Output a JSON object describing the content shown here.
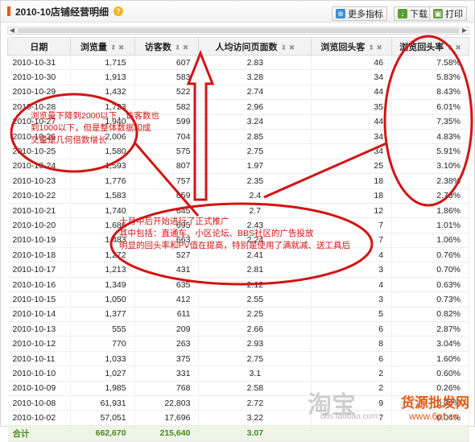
{
  "header": {
    "title": "2010-10店铺经营明细",
    "more_metrics_label": "更多指标",
    "download_label": "下载",
    "print_label": "打印"
  },
  "table": {
    "columns": [
      "日期",
      "浏览量",
      "访客数",
      "人均访问页面数",
      "浏览回头客",
      "浏览回头率"
    ],
    "rows": [
      [
        "2010-10-31",
        "1,715",
        "607",
        "2.83",
        "46",
        "7.58%"
      ],
      [
        "2010-10-30",
        "1,913",
        "583",
        "3.28",
        "34",
        "5.83%"
      ],
      [
        "2010-10-29",
        "1,432",
        "522",
        "2.74",
        "44",
        "8.43%"
      ],
      [
        "2010-10-28",
        "1,723",
        "582",
        "2.96",
        "35",
        "6.01%"
      ],
      [
        "2010-10-27",
        "1,940",
        "599",
        "3.24",
        "44",
        "7.35%"
      ],
      [
        "2010-10-26",
        "2,006",
        "704",
        "2.85",
        "34",
        "4.83%"
      ],
      [
        "2010-10-25",
        "1,580",
        "575",
        "2.75",
        "34",
        "5.91%"
      ],
      [
        "2010-10-24",
        "1,593",
        "807",
        "1.97",
        "25",
        "3.10%"
      ],
      [
        "2010-10-23",
        "1,776",
        "757",
        "2.35",
        "18",
        "2.38%"
      ],
      [
        "2010-10-22",
        "1,583",
        "659",
        "2.4",
        "18",
        "2.73%"
      ],
      [
        "2010-10-21",
        "1,740",
        "645",
        "2.7",
        "12",
        "1.86%"
      ],
      [
        "2010-10-20",
        "1,686",
        "695",
        "2.43",
        "7",
        "1.01%"
      ],
      [
        "2010-10-19",
        "1,483",
        "663",
        "2.24",
        "7",
        "1.06%"
      ],
      [
        "2010-10-18",
        "1,272",
        "527",
        "2.41",
        "4",
        "0.76%"
      ],
      [
        "2010-10-17",
        "1,213",
        "431",
        "2.81",
        "3",
        "0.70%"
      ],
      [
        "2010-10-16",
        "1,349",
        "635",
        "2.12",
        "4",
        "0.63%"
      ],
      [
        "2010-10-15",
        "1,050",
        "412",
        "2.55",
        "3",
        "0.73%"
      ],
      [
        "2010-10-14",
        "1,377",
        "611",
        "2.25",
        "5",
        "0.82%"
      ],
      [
        "2010-10-13",
        "555",
        "209",
        "2.66",
        "6",
        "2.87%"
      ],
      [
        "2010-10-12",
        "770",
        "263",
        "2.93",
        "8",
        "3.04%"
      ],
      [
        "2010-10-11",
        "1,033",
        "375",
        "2.75",
        "6",
        "1.60%"
      ],
      [
        "2010-10-10",
        "1,027",
        "331",
        "3.1",
        "2",
        "0.60%"
      ],
      [
        "2010-10-09",
        "1,985",
        "768",
        "2.58",
        "2",
        "0.26%"
      ],
      [
        "2010-10-08",
        "61,931",
        "22,803",
        "2.72",
        "9",
        "0.04%"
      ],
      [
        "2010-10-02",
        "57,051",
        "17,696",
        "3.22",
        "7",
        "0.04%"
      ]
    ],
    "total": [
      "合计",
      "662,670",
      "215,640",
      "3.07",
      "",
      ""
    ]
  },
  "annotations": {
    "left_note": [
      "浏览量下降到2000以下，访客数也",
      "到1000以下，但是整体数据和成",
      "交量是几何倍数增长"
    ],
    "bottom_note": [
      "十月中后开始进行了正式推广",
      "其中包括：直通车、小区论坛、BBS社区的广告投放",
      "明显的回头率和PV值在提高，特别是使用了满就减、送工具后"
    ],
    "accent_color": "#d21414"
  },
  "watermarks": {
    "taobao": "淘宝",
    "bbs_url": "bbs.taobao.com",
    "site_name": "货源批发网",
    "site_url": "www.6pf.cn"
  }
}
